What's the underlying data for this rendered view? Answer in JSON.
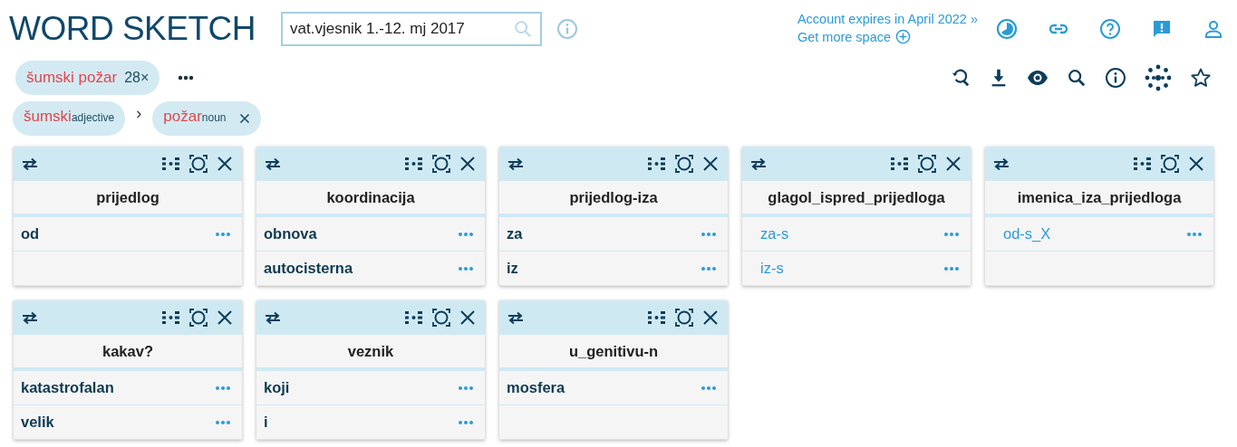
{
  "title": "WORD SKETCH",
  "search": {
    "value": "vat.vjesnik 1.-12. mj 2017"
  },
  "account": {
    "expiry": "Account expires in April 2022 »",
    "more_space": "Get more space"
  },
  "query_chip": {
    "label": "šumski požar",
    "count": "28×"
  },
  "lemma_chips": [
    {
      "word": "šumski",
      "pos": "adjective",
      "removable": false
    },
    {
      "word": "požar",
      "pos": "noun",
      "removable": true
    }
  ],
  "separator": "›",
  "cards": [
    {
      "title": "prijedlog",
      "rows": [
        {
          "kind": "word",
          "text": "od"
        }
      ]
    },
    {
      "title": "koordinacija",
      "rows": [
        {
          "kind": "word",
          "text": "obnova"
        },
        {
          "kind": "word",
          "text": "autocisterna"
        }
      ]
    },
    {
      "title": "prijedlog-iza",
      "rows": [
        {
          "kind": "word",
          "text": "za"
        },
        {
          "kind": "word",
          "text": "iz"
        }
      ]
    },
    {
      "title": "glagol_ispred_prijedloga",
      "rows": [
        {
          "kind": "link",
          "text": "za-s"
        },
        {
          "kind": "link",
          "text": "iz-s"
        }
      ]
    },
    {
      "title": "imenica_iza_prijedloga",
      "rows": [
        {
          "kind": "link",
          "text": "od-s_X"
        }
      ]
    },
    {
      "title": "kakav?",
      "rows": [
        {
          "kind": "word",
          "text": "katastrofalan"
        },
        {
          "kind": "word",
          "text": "velik"
        }
      ]
    },
    {
      "title": "veznik",
      "rows": [
        {
          "kind": "word",
          "text": "koji"
        },
        {
          "kind": "word",
          "text": "i"
        }
      ]
    },
    {
      "title": "u_genitivu-n",
      "rows": [
        {
          "kind": "word",
          "text": "mosfera"
        }
      ]
    }
  ]
}
